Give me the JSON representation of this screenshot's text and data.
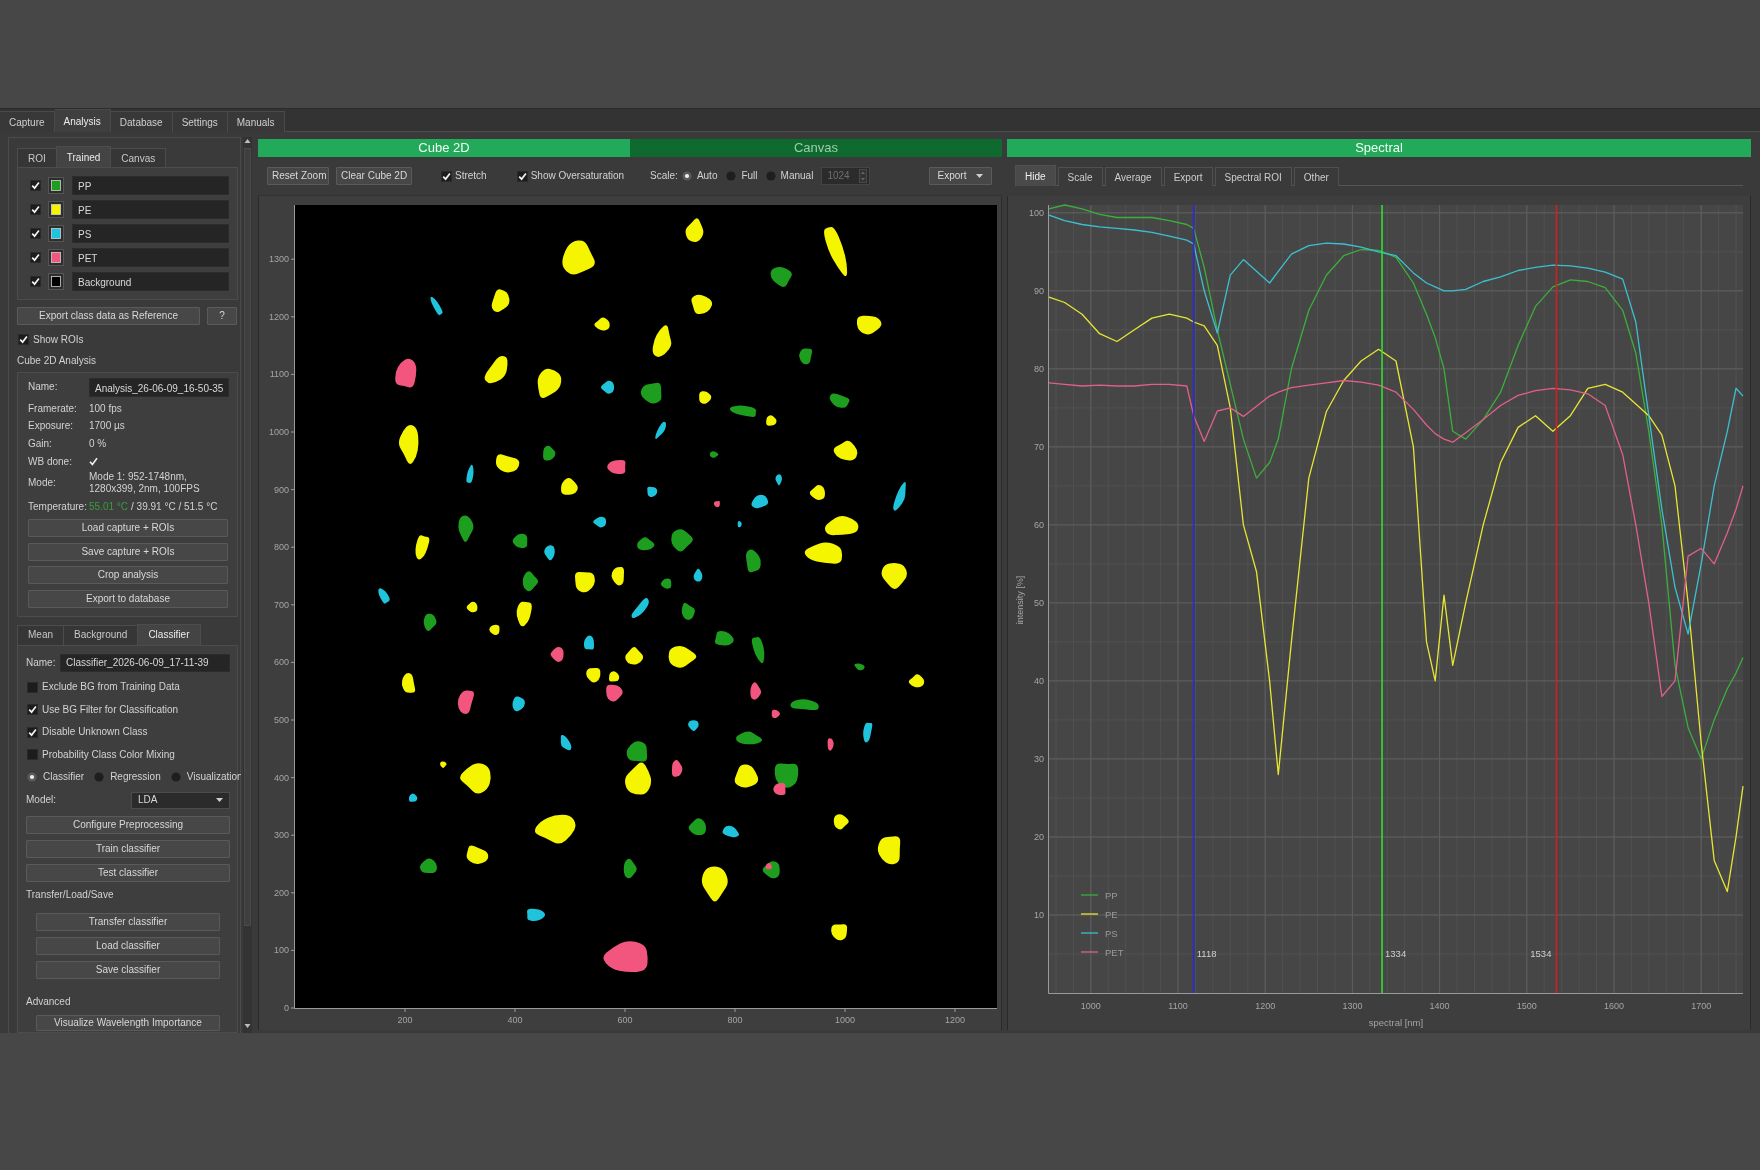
{
  "main_tabs": [
    {
      "label": "Capture",
      "selected": false
    },
    {
      "label": "Analysis",
      "selected": true
    },
    {
      "label": "Database",
      "selected": false
    },
    {
      "label": "Settings",
      "selected": false
    },
    {
      "label": "Manuals",
      "selected": false
    }
  ],
  "left_panel": {
    "class_tabs": [
      {
        "label": "ROI",
        "selected": false
      },
      {
        "label": "Trained",
        "selected": true
      },
      {
        "label": "Canvas",
        "selected": false
      }
    ],
    "classes": [
      {
        "name": "PP",
        "checked": true,
        "color": "#1e9e1e"
      },
      {
        "name": "PE",
        "checked": true,
        "color": "#f5f500"
      },
      {
        "name": "PS",
        "checked": true,
        "color": "#1fc3dc"
      },
      {
        "name": "PET",
        "checked": true,
        "color": "#f2567e"
      },
      {
        "name": "Background",
        "checked": true,
        "color": "#000000"
      }
    ],
    "export_button": "Export class data as Reference",
    "help_button": "?",
    "show_rois": {
      "label": "Show ROIs",
      "checked": true
    },
    "analysis": {
      "title": "Cube 2D Analysis",
      "fields": [
        {
          "kind": "input",
          "label": "Name:",
          "value": "Analysis_26-06-09_16-50-35"
        },
        {
          "kind": "text",
          "label": "Framerate:",
          "value": "100 fps"
        },
        {
          "kind": "text",
          "label": "Exposure:",
          "value": "1700 µs"
        },
        {
          "kind": "text",
          "label": "Gain:",
          "value": "0 %"
        },
        {
          "kind": "check",
          "label": "WB done:",
          "checked": true
        },
        {
          "kind": "text",
          "label": "Mode:",
          "value": "Mode 1: 952-1748nm, 1280x399, 2nm, 100FPS"
        },
        {
          "kind": "readings",
          "label": "Temperature:",
          "readings": [
            {
              "text": "55.01 °C",
              "highlight": true
            },
            {
              "text": "/ 39.91 °C / 51.5 °C",
              "highlight": false
            }
          ]
        }
      ],
      "buttons": [
        "Load capture + ROIs",
        "Save capture + ROIs",
        "Crop analysis",
        "Export to database"
      ]
    },
    "classifier_tabs": [
      {
        "label": "Mean",
        "selected": false
      },
      {
        "label": "Background",
        "selected": false
      },
      {
        "label": "Classifier",
        "selected": true
      }
    ],
    "classifier": {
      "name_label": "Name:",
      "name_value": "Classifier_2026-06-09_17-11-39",
      "options": [
        {
          "label": "Exclude BG from Training Data",
          "checked": false
        },
        {
          "label": "Use BG Filter for Classification",
          "checked": true
        },
        {
          "label": "Disable Unknown Class",
          "checked": true
        },
        {
          "label": "Probability Class Color Mixing",
          "checked": false
        }
      ],
      "modes": [
        {
          "label": "Classifier",
          "selected": true
        },
        {
          "label": "Regression",
          "selected": false
        },
        {
          "label": "Visualization",
          "selected": false
        }
      ],
      "model_label": "Model:",
      "model_value": "LDA",
      "buttons": [
        "Configure Preprocessing",
        "Train classifier",
        "Test classifier"
      ],
      "transfer_title": "Transfer/Load/Save",
      "transfer_buttons": [
        "Transfer classifier",
        "Load classifier",
        "Save classifier"
      ],
      "advanced_title": "Advanced",
      "advanced_buttons": [
        "Visualize Wavelength Importance"
      ]
    }
  },
  "cube_panel": {
    "tabs": [
      {
        "label": "Cube 2D",
        "selected": true
      },
      {
        "label": "Canvas",
        "selected": false
      }
    ],
    "toolbar": {
      "buttons": [
        "Reset Zoom",
        "Clear Cube 2D"
      ],
      "toggles": [
        {
          "label": "Stretch",
          "checked": true
        },
        {
          "label": "Show Oversaturation",
          "checked": true
        }
      ],
      "scale_label": "Scale:",
      "scale_options": [
        {
          "label": "Auto",
          "selected": true
        },
        {
          "label": "Full",
          "selected": false
        },
        {
          "label": "Manual",
          "selected": false
        }
      ],
      "manual_value": "1024",
      "manual_disabled": true,
      "export_button": "Export"
    },
    "canvas": {
      "y_ticks": [
        "1300",
        "1200",
        "1100",
        "1000",
        "900",
        "800",
        "700",
        "600",
        "500",
        "400",
        "300",
        "200",
        "100",
        "0"
      ],
      "x_ticks": [
        "200",
        "400",
        "600",
        "800",
        "1000",
        "1200"
      ]
    }
  },
  "spectral_panel": {
    "title": "Spectral",
    "tabs": [
      {
        "label": "Hide",
        "selected": true
      },
      {
        "label": "Scale",
        "selected": false
      },
      {
        "label": "Average",
        "selected": false
      },
      {
        "label": "Export",
        "selected": false
      },
      {
        "label": "Spectral ROI",
        "selected": false
      },
      {
        "label": "Other",
        "selected": false
      }
    ],
    "chart_data": {
      "type": "line",
      "xlabel": "spectral [nm]",
      "ylabel": "intensity [%]",
      "x": [
        952,
        970,
        990,
        1010,
        1030,
        1050,
        1070,
        1090,
        1110,
        1118,
        1130,
        1145,
        1160,
        1175,
        1190,
        1205,
        1215,
        1230,
        1250,
        1270,
        1290,
        1310,
        1330,
        1350,
        1370,
        1385,
        1395,
        1405,
        1415,
        1430,
        1450,
        1470,
        1490,
        1510,
        1530,
        1550,
        1570,
        1590,
        1610,
        1625,
        1640,
        1655,
        1670,
        1685,
        1700,
        1715,
        1730,
        1740,
        1748
      ],
      "series": [
        {
          "name": "PP",
          "color": "#3cae3c",
          "values": [
            100.5,
            101,
            100.5,
            99.8,
            99.4,
            99.4,
            99.4,
            99,
            98.5,
            98,
            93,
            85,
            78,
            71,
            66,
            68,
            71,
            80,
            87.5,
            92,
            94.5,
            95.3,
            95.2,
            94.3,
            91,
            87,
            84,
            80,
            72,
            71,
            73.5,
            77,
            83,
            88,
            90.5,
            91.4,
            91.2,
            90.4,
            87.5,
            82,
            72,
            60,
            42,
            34,
            30,
            35,
            39,
            41,
            43
          ]
        },
        {
          "name": "PE",
          "color": "#e6e633",
          "values": [
            89.2,
            88.5,
            87,
            84.5,
            83.5,
            85,
            86.5,
            87,
            86.5,
            86,
            85.5,
            83,
            75,
            60,
            54,
            40,
            28,
            45,
            66,
            74.5,
            78.5,
            81,
            82.5,
            81,
            70,
            45,
            40,
            51,
            42,
            50,
            60,
            68,
            72.5,
            74,
            72,
            74,
            77.5,
            78,
            77,
            75.5,
            74,
            71.5,
            65,
            50,
            32,
            17,
            13,
            20,
            26.5
          ]
        },
        {
          "name": "PS",
          "color": "#3cc0d0",
          "values": [
            99.7,
            99,
            98.5,
            98.2,
            98,
            97.8,
            97.5,
            97,
            96.5,
            96,
            90,
            84.6,
            92,
            94,
            92.5,
            91,
            92.5,
            94.7,
            95.8,
            96.1,
            96,
            95.6,
            95,
            94.5,
            92.3,
            91,
            90.5,
            90,
            90,
            90.2,
            91.2,
            91.8,
            92.6,
            93,
            93.3,
            93.2,
            92.9,
            92.4,
            91.5,
            86,
            74,
            62,
            52,
            46,
            55,
            65,
            72,
            77.5,
            76.5
          ]
        },
        {
          "name": "PET",
          "color": "#e0608a",
          "values": [
            78.2,
            78,
            77.8,
            77.9,
            77.8,
            77.8,
            78,
            78,
            77.8,
            74,
            70.7,
            74.6,
            75,
            73.9,
            75.2,
            76.5,
            77,
            77.6,
            77.9,
            78.2,
            78.5,
            78.3,
            77.9,
            77,
            74.8,
            72.8,
            71.7,
            71,
            70.6,
            71.8,
            73.5,
            75.3,
            76.6,
            77.2,
            77.5,
            77.3,
            76.8,
            75.3,
            69,
            60,
            50,
            38,
            40,
            56,
            57,
            55,
            59,
            62,
            65
          ]
        }
      ],
      "xlim": [
        952,
        1748
      ],
      "ylim": [
        0,
        101
      ],
      "xticks": [
        1000,
        1100,
        1200,
        1300,
        1400,
        1500,
        1600,
        1700
      ],
      "yticks": [
        10,
        20,
        30,
        40,
        50,
        60,
        70,
        80,
        90,
        100
      ],
      "grid": true,
      "legend": "lower left",
      "ref_lines": [
        {
          "axis": "x",
          "value": 1118,
          "label": "1118",
          "color": "#2a2ad8"
        },
        {
          "axis": "x",
          "value": 1334,
          "label": "1334",
          "color": "#30e030"
        },
        {
          "axis": "x",
          "value": 1534,
          "label": "1534",
          "color": "#d02020"
        }
      ]
    }
  }
}
